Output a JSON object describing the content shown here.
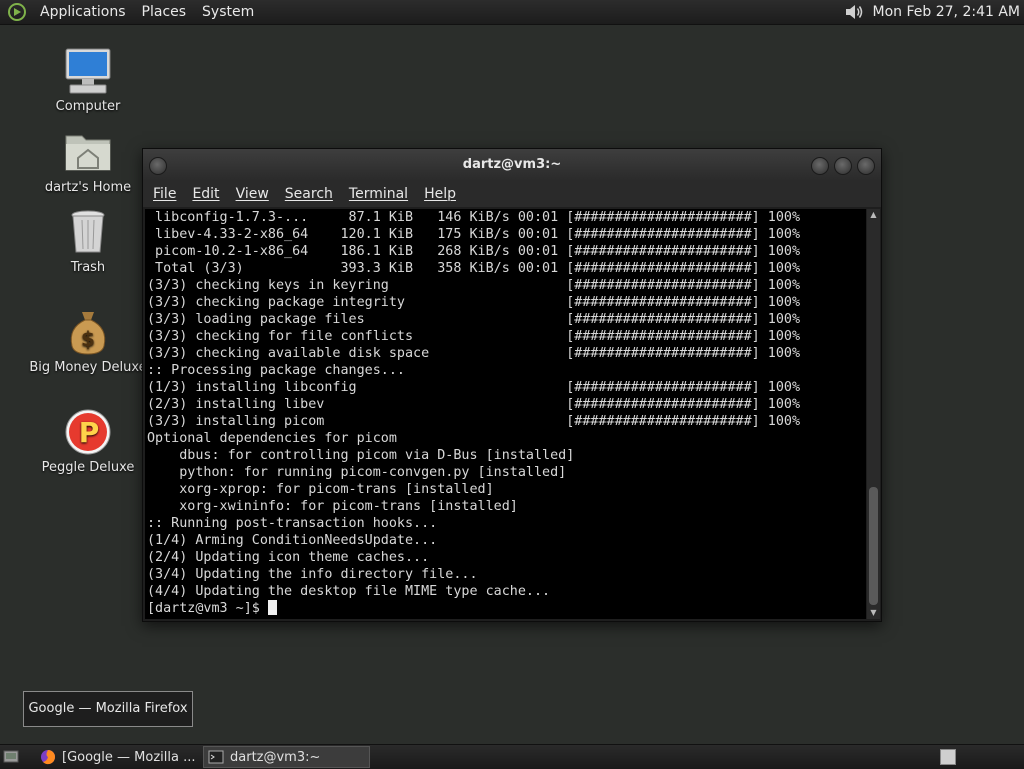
{
  "top_panel": {
    "menus": [
      "Applications",
      "Places",
      "System"
    ],
    "clock": "Mon Feb 27,  2:41 AM",
    "volume_icon": "speaker-icon"
  },
  "desktop": {
    "icons": [
      {
        "label": "Computer",
        "icon": "computer-icon"
      },
      {
        "label": "dartz's Home",
        "icon": "home-folder-icon"
      },
      {
        "label": "Trash",
        "icon": "trash-icon"
      },
      {
        "label": "Big Money Deluxe",
        "icon": "money-bag-icon"
      },
      {
        "label": "Peggle Deluxe",
        "icon": "peggle-icon"
      }
    ]
  },
  "terminal": {
    "title": "dartz@vm3:~",
    "menu": [
      "File",
      "Edit",
      "View",
      "Search",
      "Terminal",
      "Help"
    ],
    "lines": [
      " libconfig-1.7.3-...     87.1 KiB   146 KiB/s 00:01 [######################] 100%",
      " libev-4.33-2-x86_64    120.1 KiB   175 KiB/s 00:01 [######################] 100%",
      " picom-10.2-1-x86_64    186.1 KiB   268 KiB/s 00:01 [######################] 100%",
      " Total (3/3)            393.3 KiB   358 KiB/s 00:01 [######################] 100%",
      "(3/3) checking keys in keyring                      [######################] 100%",
      "(3/3) checking package integrity                    [######################] 100%",
      "(3/3) loading package files                         [######################] 100%",
      "(3/3) checking for file conflicts                   [######################] 100%",
      "(3/3) checking available disk space                 [######################] 100%",
      ":: Processing package changes...",
      "(1/3) installing libconfig                          [######################] 100%",
      "(2/3) installing libev                              [######################] 100%",
      "(3/3) installing picom                              [######################] 100%",
      "Optional dependencies for picom",
      "    dbus: for controlling picom via D-Bus [installed]",
      "    python: for running picom-convgen.py [installed]",
      "    xorg-xprop: for picom-trans [installed]",
      "    xorg-xwininfo: for picom-trans [installed]",
      ":: Running post-transaction hooks...",
      "(1/4) Arming ConditionNeedsUpdate...",
      "(2/4) Updating icon theme caches...",
      "(3/4) Updating the info directory file...",
      "(4/4) Updating the desktop file MIME type cache..."
    ],
    "prompt": "[dartz@vm3 ~]$ "
  },
  "tooltip": "Google — Mozilla Firefox",
  "taskbar": {
    "tasks": [
      {
        "label": "[Google — Mozilla ...",
        "icon": "firefox-icon"
      },
      {
        "label": "dartz@vm3:~",
        "icon": "terminal-icon"
      }
    ]
  }
}
